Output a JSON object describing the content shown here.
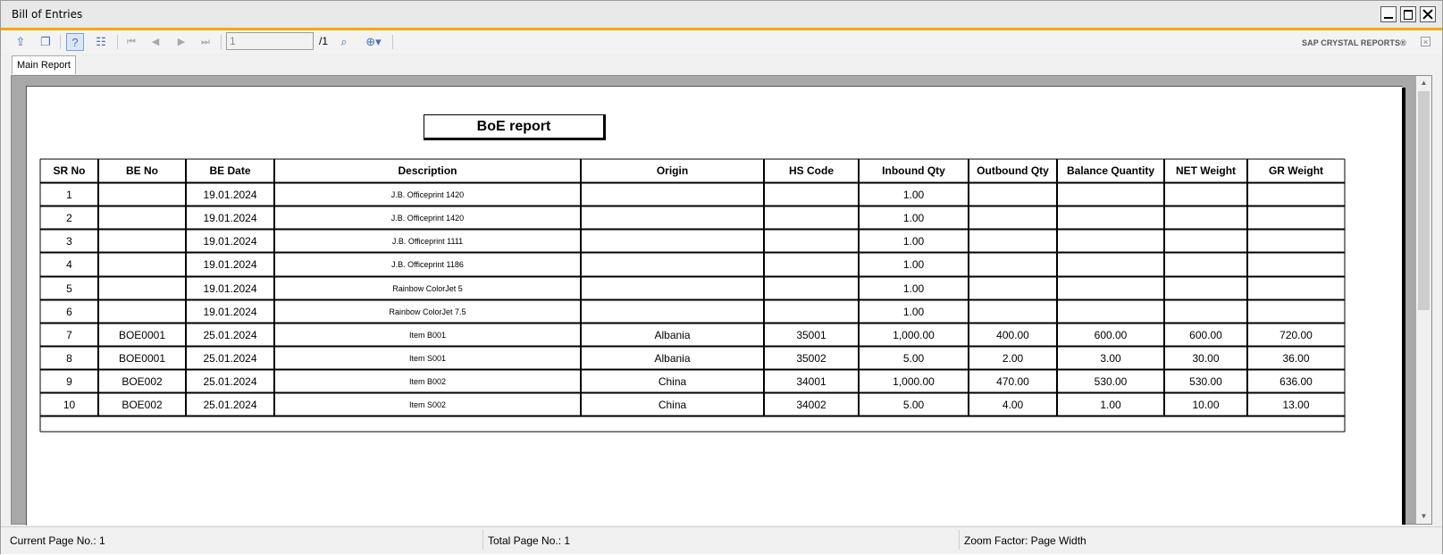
{
  "window": {
    "title": "Bill of Entries"
  },
  "toolbar": {
    "page_input": "1",
    "page_total": "/1",
    "brand": "SAP CRYSTAL REPORTS®",
    "icons": [
      "export-icon",
      "copy-icon",
      "help-icon",
      "group-tree-icon",
      "first-page-icon",
      "previous-page-icon",
      "next-page-icon",
      "last-page-icon",
      "find-icon",
      "zoom-icon"
    ]
  },
  "tabs": {
    "main": "Main Report"
  },
  "report": {
    "title": "BoE report",
    "columns": [
      "SR No",
      "BE No",
      "BE Date",
      "Description",
      "Origin",
      "HS Code",
      "Inbound Qty",
      "Outbound Qty",
      "Balance Quantity",
      "NET Weight",
      "GR Weight"
    ],
    "rows": [
      [
        "1",
        "",
        "19.01.2024",
        "J.B. Officeprint 1420",
        "",
        "",
        "1.00",
        "",
        "",
        "",
        ""
      ],
      [
        "2",
        "",
        "19.01.2024",
        "J.B. Officeprint 1420",
        "",
        "",
        "1.00",
        "",
        "",
        "",
        ""
      ],
      [
        "3",
        "",
        "19.01.2024",
        "J.B. Officeprint 1111",
        "",
        "",
        "1.00",
        "",
        "",
        "",
        ""
      ],
      [
        "4",
        "",
        "19.01.2024",
        "J.B. Officeprint 1186",
        "",
        "",
        "1.00",
        "",
        "",
        "",
        ""
      ],
      [
        "5",
        "",
        "19.01.2024",
        "Rainbow ColorJet 5",
        "",
        "",
        "1.00",
        "",
        "",
        "",
        ""
      ],
      [
        "6",
        "",
        "19.01.2024",
        "Rainbow ColorJet 7.5",
        "",
        "",
        "1.00",
        "",
        "",
        "",
        ""
      ],
      [
        "7",
        "BOE0001",
        "25.01.2024",
        "Item B001",
        "Albania",
        "35001",
        "1,000.00",
        "400.00",
        "600.00",
        "600.00",
        "720.00"
      ],
      [
        "8",
        "BOE0001",
        "25.01.2024",
        "Item S001",
        "Albania",
        "35002",
        "5.00",
        "2.00",
        "3.00",
        "30.00",
        "36.00"
      ],
      [
        "9",
        "BOE002",
        "25.01.2024",
        "Item B002",
        "China",
        "34001",
        "1,000.00",
        "470.00",
        "530.00",
        "530.00",
        "636.00"
      ],
      [
        "10",
        "BOE002",
        "25.01.2024",
        "Item S002",
        "China",
        "34002",
        "5.00",
        "4.00",
        "1.00",
        "10.00",
        "13.00"
      ]
    ]
  },
  "status": {
    "current_page": "Current Page No.: 1",
    "total_page": "Total Page No.: 1",
    "zoom": "Zoom Factor: Page Width"
  }
}
